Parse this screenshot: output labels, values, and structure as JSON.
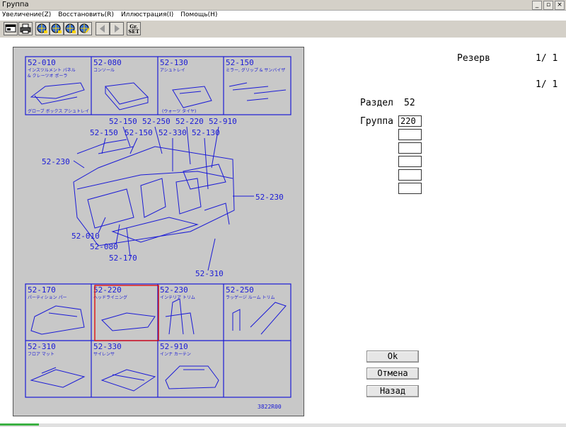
{
  "window": {
    "title": "Группа",
    "buttons": [
      "_",
      "▫",
      "×"
    ]
  },
  "menu": [
    "Увеличение(Z)",
    "Восстановить(R)",
    "Иллюстрация(I)",
    "Помощь(H)"
  ],
  "toolbar": {
    "gr_line1": "Gr.",
    "gr_line2": "SET"
  },
  "illustration": {
    "code": "3822R00",
    "top_cells": [
      {
        "part": "52-010",
        "jp1": "インスツルメント パネル",
        "jp2": "& クレーツオ ポーラ",
        "jp3": "グローブ ボックス アシュトレイ"
      },
      {
        "part": "52-080",
        "jp1": "コンソール"
      },
      {
        "part": "52-130",
        "jp1": "アシュトレイ",
        "jp2": "(ウォーツ タイヤ)"
      },
      {
        "part": "52-150",
        "jp1": "ミラー, グリップ & サンバイザ"
      }
    ],
    "middle_labels": [
      "52-150",
      "52-250",
      "52-220",
      "52-910",
      "52-150",
      "52-150",
      "52-330",
      "52-130",
      "52-230",
      "52-230",
      "52-010",
      "52-080",
      "52-170",
      "52-310"
    ],
    "bottom_cells": [
      {
        "part": "52-170",
        "jp1": "パーティション パー"
      },
      {
        "part": "52-220",
        "jp1": "ヘッドライニング"
      },
      {
        "part": "52-230",
        "jp1": "インテリア トリム"
      },
      {
        "part": "52-250",
        "jp1": "ラッゲージ ルーム トリム"
      },
      {
        "part": "52-310",
        "jp1": "フロア マット"
      },
      {
        "part": "52-330",
        "jp1": "サイレンサ"
      },
      {
        "part": "52-910",
        "jp1": "インナ カーテン"
      }
    ],
    "selected_part": "52-220"
  },
  "right": {
    "reserve_label": "Резерв",
    "page1": "1/ 1",
    "page2": "1/ 1",
    "section_label": "Раздел",
    "section_value": "52",
    "group_label": "Группа",
    "group_values": [
      "220",
      "",
      "",
      "",
      "",
      ""
    ]
  },
  "buttons": {
    "ok": "Ok",
    "cancel": "Отмена",
    "back": "Назад"
  }
}
